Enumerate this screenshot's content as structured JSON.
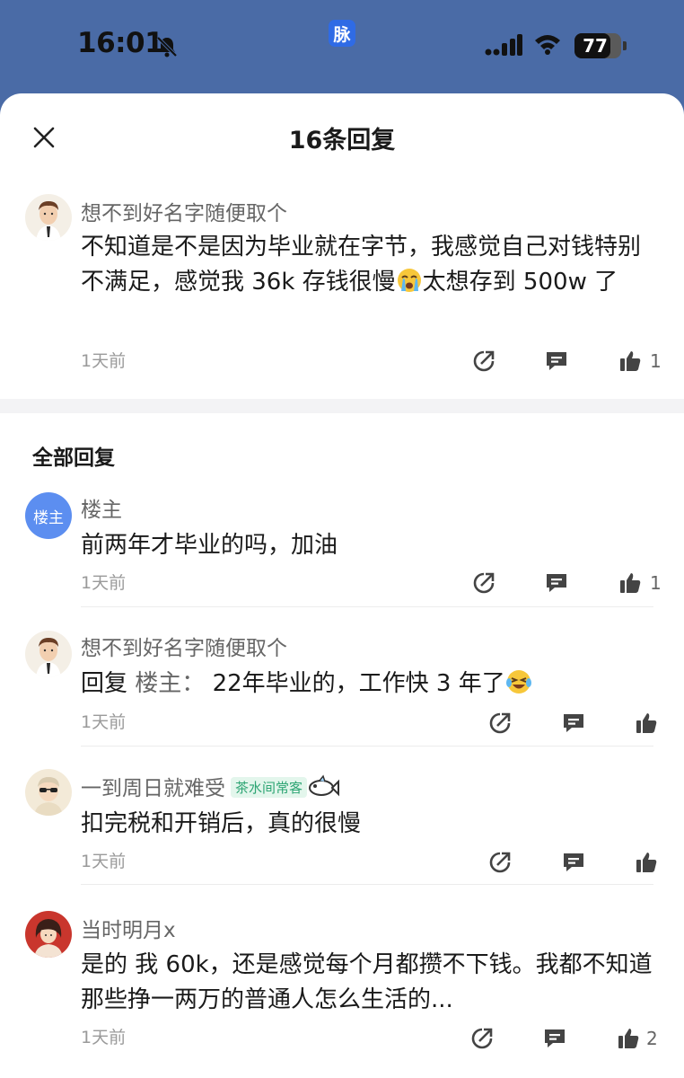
{
  "status": {
    "time": "16:01",
    "app_badge": "脉",
    "battery": "77",
    "battery_level": 0.77
  },
  "sheet": {
    "title": "16条回复"
  },
  "main_post": {
    "author": "想不到好名字随便取个",
    "text_before_emoji": "不知道是不是因为毕业就在字节，我感觉自己对钱特别不满足，感觉我 36k 存钱很慢",
    "emoji": "crying-emoji",
    "text_after_emoji": "太想存到 500w 了",
    "time": "1天前",
    "like_count": "1"
  },
  "section_title": "全部回复",
  "replies": [
    {
      "author": "楼主",
      "avatar_text": "楼主",
      "text": "前两年才毕业的吗，加油",
      "time": "1天前",
      "like_count": "1"
    },
    {
      "author": "想不到好名字随便取个",
      "reply_prefix": "回复",
      "reply_target": "楼主：",
      "text": "22年毕业的，工作快 3 年了",
      "emoji": "laughing-tears-emoji",
      "time": "1天前",
      "like_count": ""
    },
    {
      "author": "一到周日就难受",
      "tag": "茶水间常客",
      "text": "扣完税和开销后，真的很慢",
      "time": "1天前",
      "like_count": ""
    },
    {
      "author": "当时明月x",
      "text": "是的 我 60k，还是感觉每个月都攒不下钱。我都不知道那些挣一两万的普通人怎么生活的...",
      "time": "1天前",
      "like_count": "2"
    }
  ],
  "colors": {
    "status_bg": "#4A6BA6",
    "app_badge": "#2F6BE5",
    "host_avatar": "#5C8EF0",
    "tag_text": "#2EA574",
    "tag_bg": "#E3F6EC"
  }
}
